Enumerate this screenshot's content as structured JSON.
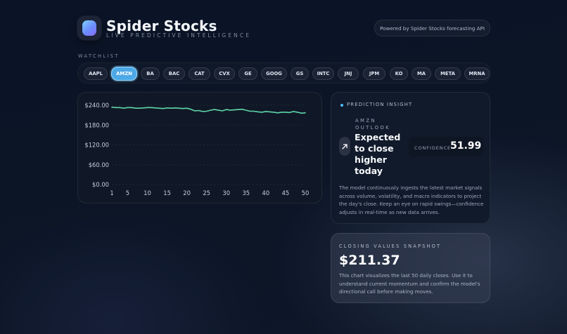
{
  "header": {
    "title": "Spider Stocks",
    "subtitle": "LIVE PREDICTIVE INTELLIGENCE",
    "powered_by": "Powered by Spider Stocks forecasting API"
  },
  "watchlist": {
    "label": "WATCHLIST",
    "selected": "AMZN",
    "tickers": [
      "AAPL",
      "AMZN",
      "BA",
      "BAC",
      "CAT",
      "CVX",
      "GE",
      "GOOG",
      "GS",
      "INTC",
      "JNJ",
      "JPM",
      "KO",
      "MA",
      "META",
      "MRNA"
    ]
  },
  "chart_data": {
    "type": "line",
    "title": "",
    "xlabel": "",
    "ylabel": "",
    "ylim": [
      0,
      240
    ],
    "xlim": [
      1,
      50
    ],
    "grid": true,
    "y_tick_labels": [
      "$240.00",
      "$180.00",
      "$120.00",
      "$60.00",
      "$0.00"
    ],
    "x_tick_labels": [
      "1",
      "5",
      "10",
      "15",
      "20",
      "25",
      "30",
      "35",
      "40",
      "45",
      "50"
    ],
    "colors": {
      "line": "#5ed6a8"
    },
    "x": [
      1,
      2,
      3,
      4,
      5,
      6,
      7,
      8,
      9,
      10,
      11,
      12,
      13,
      14,
      15,
      16,
      17,
      18,
      19,
      20,
      21,
      22,
      23,
      24,
      25,
      26,
      27,
      28,
      29,
      30,
      31,
      32,
      33,
      34,
      35,
      36,
      37,
      38,
      39,
      40,
      41,
      42,
      43,
      44,
      45,
      46,
      47,
      48,
      49,
      50
    ],
    "series": [
      {
        "values": [
          234,
          233,
          233,
          231,
          233,
          233,
          231,
          231,
          232,
          233,
          233,
          232,
          231,
          230,
          232,
          231,
          232,
          231,
          230,
          231,
          228,
          223,
          224,
          221,
          222,
          225,
          227,
          225,
          223,
          227,
          225,
          226,
          227,
          228,
          225,
          222,
          222,
          220,
          219,
          221,
          220,
          219,
          217,
          219,
          219,
          218,
          221,
          219,
          216,
          217
        ]
      }
    ]
  },
  "insight": {
    "label": "PREDICTION INSIGHT",
    "ticker": "AMZN",
    "outlook": "OUTLOOK",
    "headline": "Expected to close higher today",
    "confidence_label": "CONFIDENCE",
    "confidence_value": "51.99",
    "body": "The model continuously ingests the latest market signals across volume, volatility, and macro indicators to project the day's close. Keep an eye on rapid swings—confidence adjusts in real-time as new data arrives."
  },
  "snapshot": {
    "label": "CLOSING VALUES SNAPSHOT",
    "value": "$211.37",
    "body": "This chart visualizes the last 50 daily closes. Use it to understand current momentum and confirm the model's directional call before making moves."
  }
}
